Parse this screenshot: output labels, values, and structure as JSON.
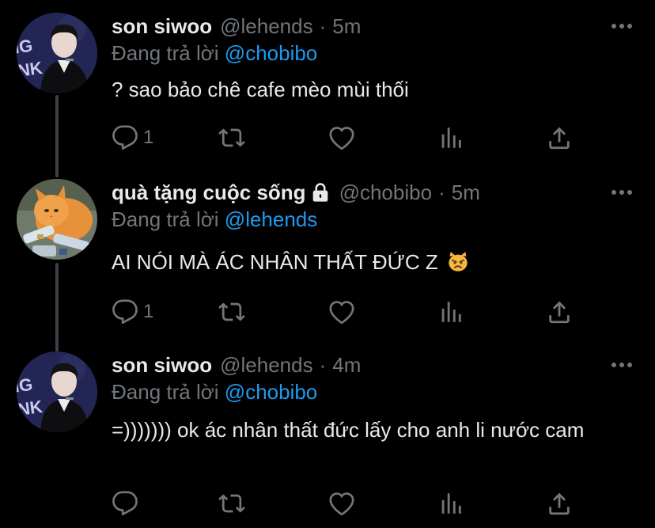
{
  "tweets": [
    {
      "name": "son siwoo",
      "handle": "@lehends",
      "separator": "·",
      "time": "5m",
      "replying_prefix": "Đang trả lời",
      "replying_to": "@chobibo",
      "text": "? sao bảo chê cafe mèo mùi thối",
      "reply_count": "1",
      "avatar": "person-avatar"
    },
    {
      "name": "quà tặng cuộc sống",
      "handle": "@chobibo",
      "separator": "·",
      "time": "5m",
      "replying_prefix": "Đang trả lời",
      "replying_to": "@lehends",
      "text": "AI NÓI MÀ ÁC NHÂN THẤT ĐỨC Z",
      "emoji": "pouting-cat",
      "reply_count": "1",
      "avatar": "cat-avatar",
      "protected": true
    },
    {
      "name": "son siwoo",
      "handle": "@lehends",
      "separator": "·",
      "time": "4m",
      "replying_prefix": "Đang trả lời",
      "replying_to": "@chobibo",
      "text": "=))))))) ok ác nhân thất đức lấy cho anh li nước cam",
      "reply_count": "",
      "avatar": "person-avatar"
    }
  ],
  "colors": {
    "background": "#000000",
    "text": "#e7e9ea",
    "secondary": "#71767b",
    "link": "#1d9bf0",
    "thread_line": "#3e4144"
  }
}
